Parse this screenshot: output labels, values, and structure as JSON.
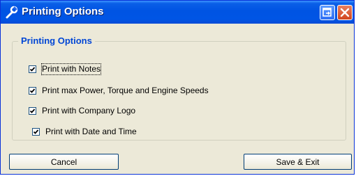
{
  "window": {
    "title": "Printing Options",
    "title_icon": "wrench-icon",
    "restore_icon": "restore-icon",
    "close_icon": "close-icon"
  },
  "group": {
    "title": "Printing Options",
    "options": [
      {
        "label": "Print with Notes",
        "checked": true
      },
      {
        "label": "Print max Power, Torque and Engine Speeds",
        "checked": true
      },
      {
        "label": "Print with Company Logo",
        "checked": true
      },
      {
        "label": "Print with Date and Time",
        "checked": true
      }
    ]
  },
  "buttons": {
    "cancel": "Cancel",
    "save_exit": "Save & Exit"
  },
  "colors": {
    "titlebar": "#0054e3",
    "group_title": "#0046d5",
    "face": "#ece9d8"
  }
}
